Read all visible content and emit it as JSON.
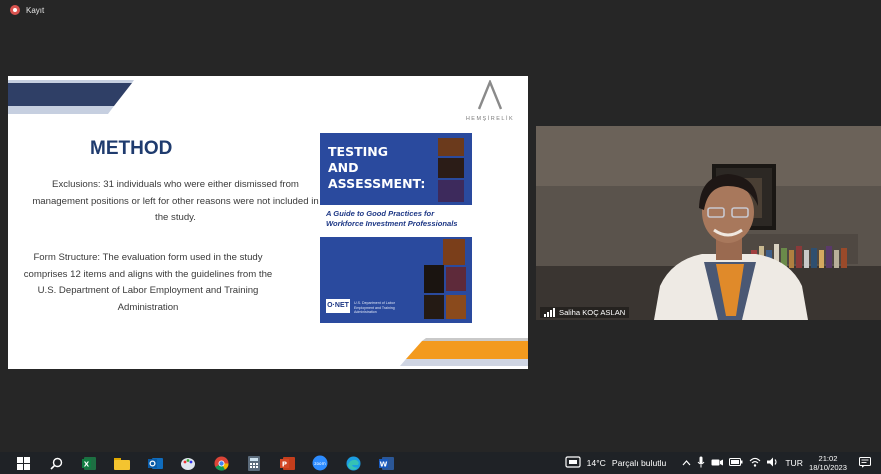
{
  "recording": {
    "label": "Kayıt"
  },
  "slide": {
    "logo_text": "HEMŞİRELİK",
    "title": "METHOD",
    "exclusions": "Exclusions: 31 individuals who were either dismissed from management positions or left for other reasons were not included in the study.",
    "form_structure": "Form Structure: The evaluation form used in the study comprises 12 items and aligns with the guidelines from the U.S. Department of Labor Employment and Training Administration",
    "cover": {
      "title_lines": [
        "TESTING",
        "AND",
        "ASSESSMENT:"
      ],
      "subtitle_lines": [
        "A Guide to Good Practices for",
        "Workforce Investment Professionals"
      ],
      "footer_logo": "O·NET",
      "footer_text": "U.S. Department of Labor Employment and Training Administration"
    }
  },
  "participant": {
    "name": "Saliha KOÇ ASLAN"
  },
  "taskbar": {
    "apps": [
      "windows-start-icon",
      "search-icon",
      "excel-icon",
      "file-explorer-icon",
      "outlook-icon",
      "paint-icon",
      "chrome-icon",
      "calculator-icon",
      "powerpoint-icon",
      "zoom-icon",
      "edge-icon",
      "word-icon"
    ],
    "weather_temp": "14°C",
    "weather_desc": "Parçalı bulutlu",
    "language": "TUR",
    "time": "21:02",
    "date": "18/10/2023"
  },
  "colors": {
    "navy": "#1f3b6e",
    "cover_blue": "#2a4a9e",
    "accent_orange": "#f39a1e",
    "taskbar": "#1f2226"
  }
}
